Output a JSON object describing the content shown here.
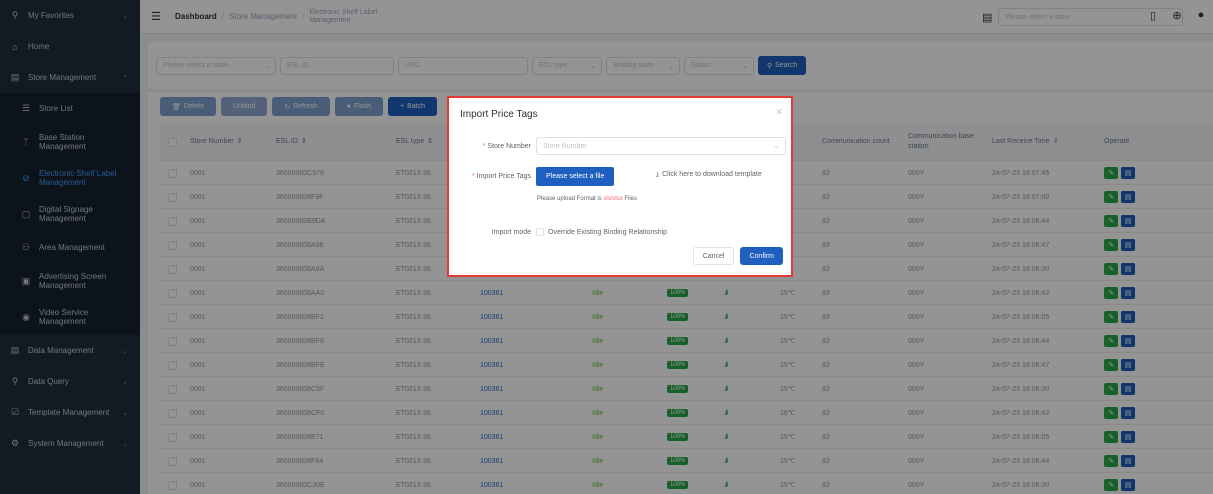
{
  "sidebar": {
    "my_favorites": "My Favorites",
    "home": "Home",
    "store_management": "Store Management",
    "sub_items": [
      {
        "label": "Store List"
      },
      {
        "label": "Base Station Management"
      },
      {
        "label": "Electronic Shelf Label Management"
      },
      {
        "label": "Digital Signage Management"
      },
      {
        "label": "Area Management"
      },
      {
        "label": "Advertising Screen Management"
      },
      {
        "label": "Video Service Management"
      }
    ],
    "data_management": "Data Management",
    "data_query": "Data Query",
    "template_management": "Template Management",
    "system_management": "System Management"
  },
  "header": {
    "breadcrumb": [
      "Dashboard",
      "Store Management",
      "Electronic Shelf Label Management"
    ],
    "store_select_placeholder": "Please select a store"
  },
  "filters": {
    "store": "Please select a store",
    "esl_id": "ESL ID",
    "upc": "UPC",
    "esl_type": "ESL type",
    "binding_state": "Binding state",
    "status": "Status",
    "search": "Search"
  },
  "toolbar": {
    "delete": "Delete",
    "unbind": "Unbind",
    "refresh": "Refresh",
    "flash": "Flash",
    "batch": "Batch"
  },
  "table": {
    "headers": {
      "store_number": "Store Number",
      "esl_id": "ESL ID",
      "esl_type": "ESL type",
      "comm_count": "Communication count",
      "comm_station": "Communication base station",
      "last_time": "Last Receive Time"
    },
    "rows": [
      {
        "store": "0001",
        "esl": "36000000C979",
        "type": "ET0213-36",
        "upc": "",
        "state": "",
        "battery": "",
        "temp": "",
        "count": "82",
        "station": "000Y",
        "time": "24-07-23 18:07:45"
      },
      {
        "store": "0001",
        "esl": "360000008F9F",
        "type": "ET0213-36",
        "upc": "",
        "state": "",
        "battery": "",
        "temp": "",
        "count": "82",
        "station": "000Y",
        "time": "24-07-23 18:07:00"
      },
      {
        "store": "0001",
        "esl": "36000000B9DA",
        "type": "ET0213-36",
        "upc": "",
        "state": "",
        "battery": "",
        "temp": "",
        "count": "82",
        "station": "000Y",
        "time": "24-07-23 18:06:44"
      },
      {
        "store": "0001",
        "esl": "360000008A96",
        "type": "ET0213-36",
        "upc": "",
        "state": "",
        "battery": "",
        "temp": "",
        "count": "83",
        "station": "000Y",
        "time": "24-07-23 18:06:47"
      },
      {
        "store": "0001",
        "esl": "360000008A8A",
        "type": "ET0213-36",
        "upc": "",
        "state": "",
        "battery": "",
        "temp": "",
        "count": "82",
        "station": "000Y",
        "time": "24-07-23 18:06:30"
      },
      {
        "store": "0001",
        "esl": "360000008AA0",
        "type": "ET0213-36",
        "upc": "100361",
        "state": "Idle",
        "battery": "100%",
        "temp": "25℃",
        "count": "83",
        "station": "000Y",
        "time": "24-07-23 18:06:42"
      },
      {
        "store": "0001",
        "esl": "360000008BF1",
        "type": "ET0213-36",
        "upc": "100361",
        "state": "Idle",
        "battery": "100%",
        "temp": "25℃",
        "count": "83",
        "station": "000Y",
        "time": "24-07-23 18:06:05"
      },
      {
        "store": "0001",
        "esl": "360000008BF8",
        "type": "ET0213-36",
        "upc": "100361",
        "state": "Idle",
        "battery": "100%",
        "temp": "25℃",
        "count": "82",
        "station": "000Y",
        "time": "24-07-23 18:06:44"
      },
      {
        "store": "0001",
        "esl": "360000008BFE",
        "type": "ET0213-36",
        "upc": "100361",
        "state": "Idle",
        "battery": "100%",
        "temp": "25℃",
        "count": "82",
        "station": "000Y",
        "time": "24-07-23 18:06:47"
      },
      {
        "store": "0001",
        "esl": "360000008C5F",
        "type": "ET0213-36",
        "upc": "100361",
        "state": "Idle",
        "battery": "100%",
        "temp": "25℃",
        "count": "82",
        "station": "000Y",
        "time": "24-07-23 18:06:30"
      },
      {
        "store": "0001",
        "esl": "360000008CF0",
        "type": "ET0213-36",
        "upc": "100361",
        "state": "Idle",
        "battery": "100%",
        "temp": "26℃",
        "count": "82",
        "station": "000Y",
        "time": "24-07-23 18:06:42"
      },
      {
        "store": "0001",
        "esl": "360000008E71",
        "type": "ET0213-36",
        "upc": "100361",
        "state": "Idle",
        "battery": "100%",
        "temp": "25℃",
        "count": "82",
        "station": "000Y",
        "time": "24-07-23 18:06:05"
      },
      {
        "store": "0001",
        "esl": "360000008F64",
        "type": "ET0213-36",
        "upc": "100361",
        "state": "Idle",
        "battery": "100%",
        "temp": "25℃",
        "count": "82",
        "station": "000Y",
        "time": "24-07-23 18:06:44"
      },
      {
        "store": "0001",
        "esl": "36000000C30E",
        "type": "ET0213-36",
        "upc": "100361",
        "state": "Idle",
        "battery": "100%",
        "temp": "25℃",
        "count": "82",
        "station": "000Y",
        "time": "24-07-23 18:06:30"
      }
    ]
  },
  "dialog": {
    "title": "Import Price Tags",
    "store_number_label": "Store Number",
    "store_number_placeholder": "Store Number",
    "import_label": "Import Price Tags",
    "select_file": "Please select a file",
    "download_template": "Click here to download template",
    "hint_prefix": "Please upload Format is ",
    "hint_format": "xls/xlsx",
    "hint_suffix": " Files",
    "import_mode_label": "Import mode",
    "override_option": "Override Existing Binding Relationship",
    "cancel": "Cancel",
    "confirm": "Confirm"
  },
  "colors": {
    "primary": "#1f5fbf",
    "sidebar_bg": "#1f2d3d",
    "active": "#409eff",
    "success": "#27a745",
    "dialog_border": "#e53935"
  }
}
